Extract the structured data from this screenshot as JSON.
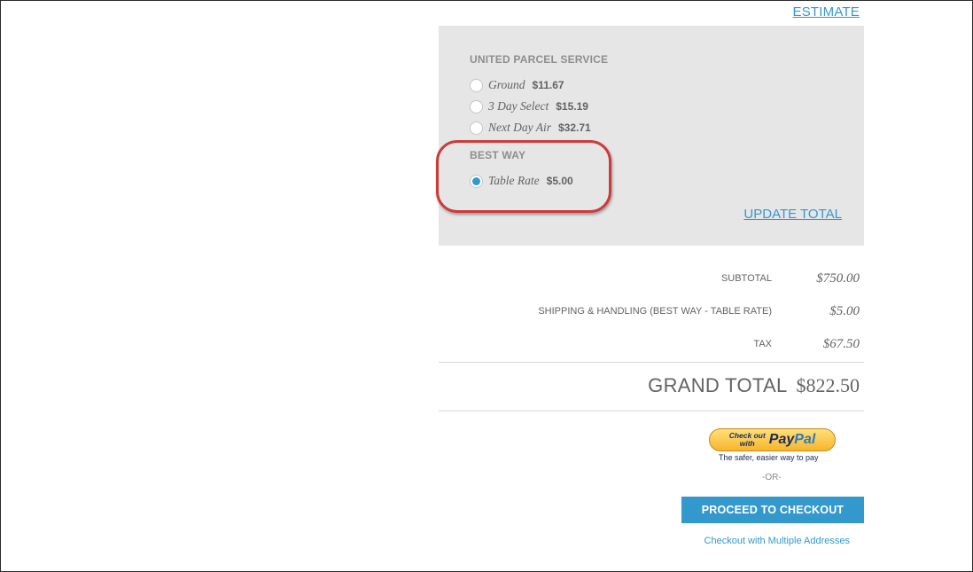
{
  "estimate_link": "ESTIMATE",
  "shipping": {
    "carriers": [
      {
        "title": "UNITED PARCEL SERVICE",
        "rates": [
          {
            "name": "Ground",
            "price": "$11.67",
            "selected": false
          },
          {
            "name": "3 Day Select",
            "price": "$15.19",
            "selected": false
          },
          {
            "name": "Next Day Air",
            "price": "$32.71",
            "selected": false
          }
        ]
      },
      {
        "title": "BEST WAY",
        "rates": [
          {
            "name": "Table Rate",
            "price": "$5.00",
            "selected": true
          }
        ]
      }
    ],
    "update_total": "UPDATE TOTAL"
  },
  "totals": {
    "subtotal_label": "SUBTOTAL",
    "subtotal_value": "$750.00",
    "shipping_label": "SHIPPING & HANDLING (BEST WAY - TABLE RATE)",
    "shipping_value": "$5.00",
    "tax_label": "TAX",
    "tax_value": "$67.50",
    "grand_label": "GRAND TOTAL",
    "grand_value": "$822.50"
  },
  "paypal": {
    "checkout_text_1": "Check out",
    "checkout_text_2": "with",
    "logo_pay": "Pay",
    "logo_pal": "Pal",
    "tagline": "The safer, easier way to pay"
  },
  "or_separator": "-OR-",
  "proceed_button": "PROCEED TO CHECKOUT",
  "multiple_addresses_link": "Checkout with Multiple Addresses",
  "colors": {
    "accent": "#3399cc",
    "panel_bg": "#e6e6e6",
    "callout": "#cc3b3b",
    "text": "#636363"
  }
}
